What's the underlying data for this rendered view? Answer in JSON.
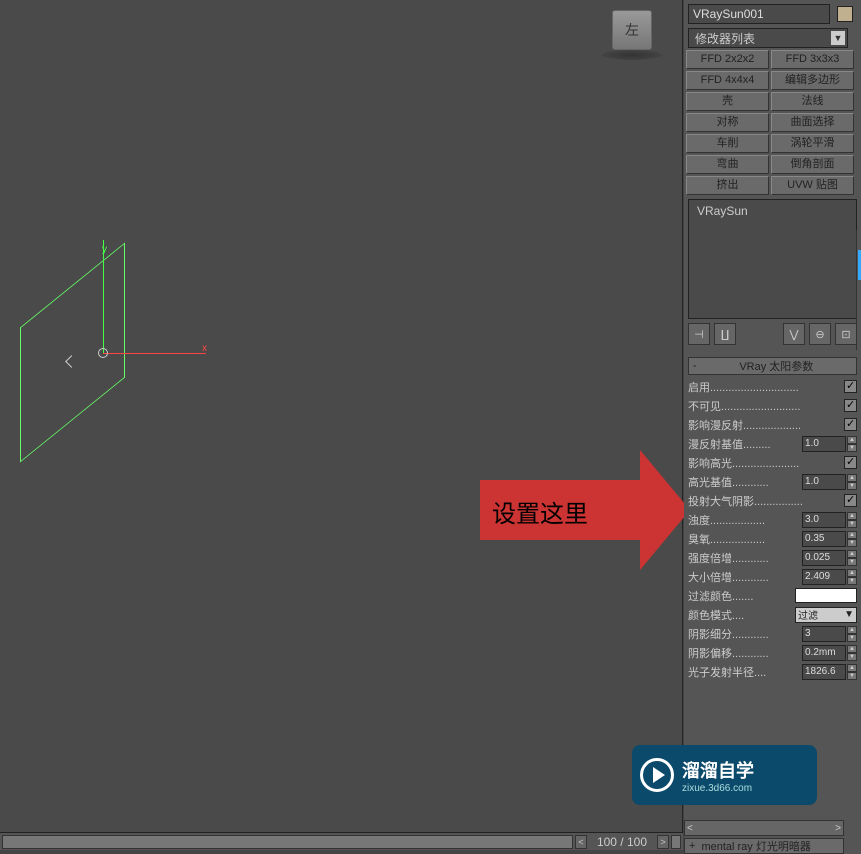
{
  "viewport": {
    "cube_face": "左",
    "axis_x": "x",
    "axis_y": "y"
  },
  "callout": {
    "text": "设置这里"
  },
  "timeline": {
    "btn_left": "<",
    "frame": "100 / 100",
    "btn_right": ">"
  },
  "bottom_timeline": {
    "btn_left": "<",
    "btn_right": ">"
  },
  "panel": {
    "object_name": "VRaySun001",
    "modifier_dropdown": "修改器列表",
    "dd_arrow": "▼",
    "mod_buttons": [
      "FFD 2x2x2",
      "FFD 3x3x3",
      "FFD 4x4x4",
      "编辑多边形",
      "壳",
      "法线",
      "对称",
      "曲面选择",
      "车削",
      "涡轮平滑",
      "弯曲",
      "倒角剖面",
      "挤出",
      "UVW 贴图"
    ],
    "stack_item": "VRaySun",
    "toolbar_icons": [
      "⊣",
      "∐",
      "⋁",
      "⊖",
      "⊡"
    ],
    "rollout1_title": "VRay 太阳参数",
    "rollout1_minus": "-",
    "params": [
      {
        "label": "启用",
        "dots": ".............................",
        "type": "check",
        "value": true
      },
      {
        "label": "不可见",
        "dots": "..........................",
        "type": "check",
        "value": true
      },
      {
        "label": "影响漫反射",
        "dots": "...................",
        "type": "check",
        "value": true
      },
      {
        "label": "漫反射基值",
        "dots": ".........",
        "type": "spin",
        "value": "1.0"
      },
      {
        "label": "影响高光",
        "dots": "......................",
        "type": "check",
        "value": true
      },
      {
        "label": "高光基值",
        "dots": "............",
        "type": "spin",
        "value": "1.0"
      },
      {
        "label": "投射大气阴影",
        "dots": "................",
        "type": "check",
        "value": true
      },
      {
        "label": "浊度",
        "dots": "..................",
        "type": "spin",
        "value": "3.0"
      },
      {
        "label": "臭氧",
        "dots": "..................",
        "type": "spin",
        "value": "0.35"
      },
      {
        "label": "强度倍增",
        "dots": "............",
        "type": "spin",
        "value": "0.025"
      },
      {
        "label": "大小倍增",
        "dots": "............",
        "type": "spin",
        "value": "2.409"
      },
      {
        "label": "过滤颜色",
        "dots": ".......",
        "type": "color",
        "value": "#ffffff"
      },
      {
        "label": "颜色模式",
        "dots": "....",
        "type": "dd",
        "value": "过滤"
      },
      {
        "label": "阴影细分",
        "dots": "............",
        "type": "spin",
        "value": "3"
      },
      {
        "label": "阴影偏移",
        "dots": "............",
        "type": "spin",
        "value": "0.2mm"
      },
      {
        "label": "光子发射半径",
        "dots": "....",
        "type": "spin",
        "value": "1826.6"
      }
    ],
    "rollout2_plus": "+",
    "rollout2_title": "mental ray 灯光明暗器"
  },
  "watermark": {
    "line1": "溜溜自学",
    "line2": "zixue.3d66.com"
  }
}
